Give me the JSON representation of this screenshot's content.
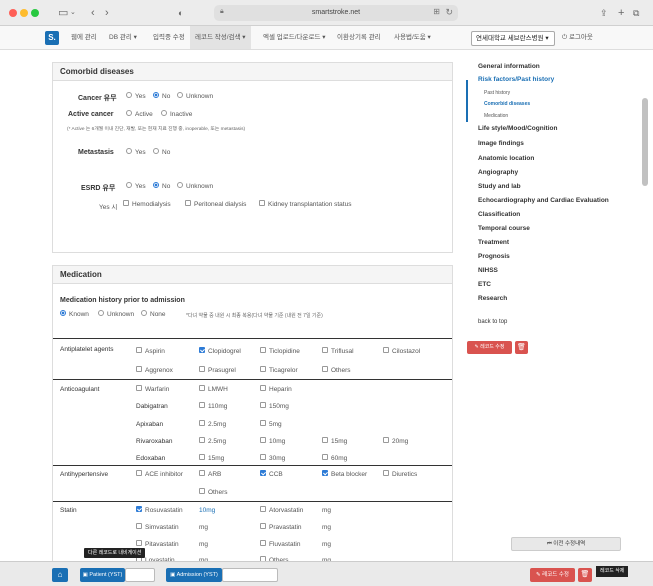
{
  "browser": {
    "url": "smartstroke.net"
  },
  "navbar": {
    "brand": "S.",
    "items": [
      "웹에 관리",
      "DB 관리 ▾",
      "입력중 수정",
      "레코드 작성/검색 ▾",
      "엑셀 업로드/다운로드 ▾",
      "이환상기록 관리",
      "사용법/도움 ▾"
    ],
    "hospital": "연세대학교 세브란스병원 ▾",
    "logout": "로그아웃"
  },
  "comorbid": {
    "title": "Comorbid diseases",
    "cancer_label": "Cancer 유무",
    "yes": "Yes",
    "no": "No",
    "unknown": "Unknown",
    "active_cancer_label": "Active cancer",
    "active": "Active",
    "inactive": "Inactive",
    "active_note": "(* Active 는 6개월 이내 진단, 재발, 또는 현재 치료 진행 중, inoperable, 또는 metastasis)",
    "metastasis_label": "Metastasis",
    "esrd_label": "ESRD 유무",
    "yes_si": "Yes 시",
    "hemodialysis": "Hemodialysis",
    "peritoneal": "Peritoneal dialysis",
    "kidney_tx": "Kidney transplantation status"
  },
  "medication": {
    "title": "Medication",
    "history_label": "Medication history prior to admission",
    "known": "Known",
    "unknown": "Unknown",
    "none": "None",
    "history_note": "*다녀 약물 중 내원 시 최종 복용(다녀 약물 기준 (내원 전 7일 기준)",
    "antiplatelet": {
      "label": "Antiplatelet agents",
      "row1": [
        "Aspirin",
        "Clopidogrel",
        "Ticlopidine",
        "Triflusal",
        "Cilostazol"
      ],
      "row2": [
        "Aggrenox",
        "Prasugrel",
        "Ticagrelor",
        "Others"
      ]
    },
    "anticoagulant": {
      "label": "Anticoagulant",
      "row1": [
        "Warfarin",
        "LMWH",
        "Heparin"
      ],
      "dabigatran": {
        "name": "Dabigatran",
        "doses": [
          "110mg",
          "150mg"
        ]
      },
      "apixaban": {
        "name": "Apixaban",
        "doses": [
          "2.5mg",
          "5mg"
        ]
      },
      "rivaroxaban": {
        "name": "Rivaroxaban",
        "doses": [
          "2.5mg",
          "10mg",
          "15mg",
          "20mg"
        ]
      },
      "edoxaban": {
        "name": "Edoxaban",
        "doses": [
          "15mg",
          "30mg",
          "60mg"
        ]
      }
    },
    "antihypertensive": {
      "label": "Antihypertensive",
      "row1": [
        "ACE inhibitor",
        "ARB",
        "CCB",
        "Beta blocker",
        "Diuretics"
      ],
      "row2": [
        "Others"
      ]
    },
    "statin": {
      "label": "Statin",
      "rows": [
        {
          "a": "Rosuvastatin",
          "a_val": "10mg",
          "b": "Atorvastatin",
          "b_val": "mg"
        },
        {
          "a": "Simvastatin",
          "a_val": "mg",
          "b": "Pravastatin",
          "b_val": "mg"
        },
        {
          "a": "Pitavastatin",
          "a_val": "mg",
          "b": "Fluvastatin",
          "b_val": "mg"
        },
        {
          "a": "Lovastatin",
          "a_val": "mg",
          "b": "Others",
          "b_val": "mg"
        }
      ]
    }
  },
  "right_nav": {
    "items": [
      "General information",
      "Risk factors/Past history",
      "Life style/Mood/Cognition",
      "Image findings",
      "Anatomic location",
      "Angiography",
      "Study and lab",
      "Echocardiography and Cardiac Evaluation",
      "Classification",
      "Temporal course",
      "Treatment",
      "Prognosis",
      "NIHSS",
      "ETC",
      "Research"
    ],
    "subs": [
      "Past history",
      "Comorbid diseases",
      "Medication"
    ],
    "back_to_top": "back to top",
    "edit_record": "레코드 수정",
    "history_btn": "이전 수정내역"
  },
  "bottom": {
    "patient_btn": "Patient (YST)",
    "admission_btn": "Admission (YST)",
    "edit_btn": "레코드 수정",
    "tooltip": "다른 레코드로 내비게이션",
    "delete_tooltip": "레코드 삭제"
  },
  "colors": {
    "primary": "#1a6fb4",
    "danger": "#d9534f"
  }
}
